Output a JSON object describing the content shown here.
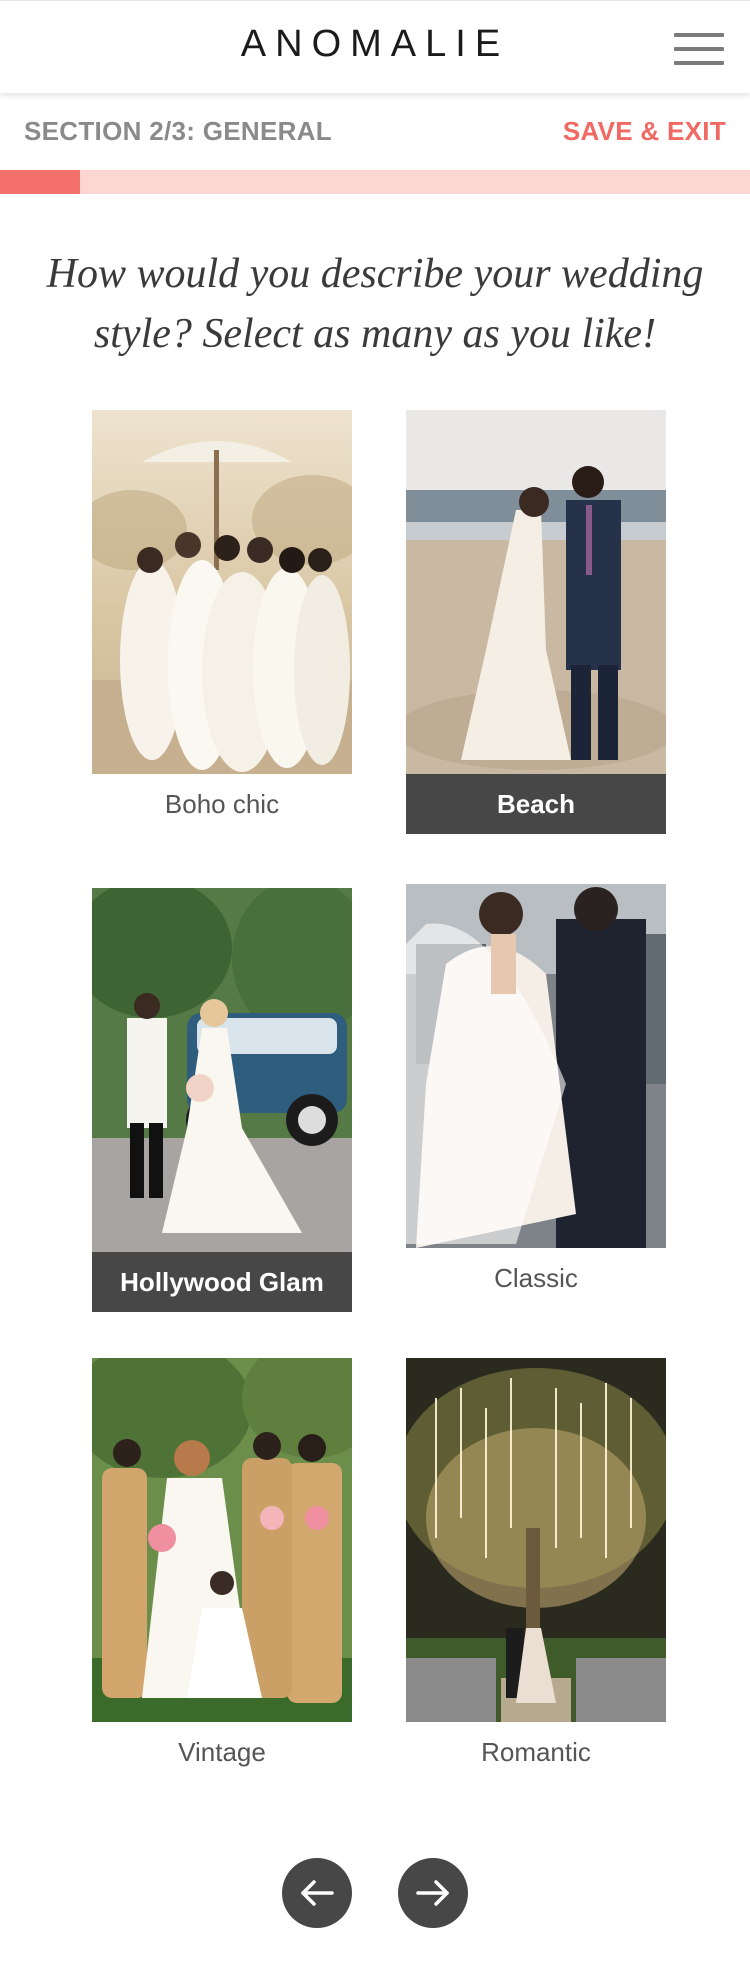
{
  "header": {
    "logo": "ANOMALIE"
  },
  "section": {
    "label": "SECTION 2/3: GENERAL",
    "save_exit": "SAVE & EXIT",
    "progress_fraction": 0.107
  },
  "question": {
    "line1": "How would you describe your wedding",
    "line2": "style? Select as many as you like!"
  },
  "styles": [
    {
      "label": "Boho chic",
      "selected": false,
      "image": "boho-photo"
    },
    {
      "label": "Beach",
      "selected": true,
      "image": "beach-photo"
    },
    {
      "label": "Hollywood Glam",
      "selected": true,
      "image": "hollywood-photo"
    },
    {
      "label": "Classic",
      "selected": false,
      "image": "classic-photo"
    },
    {
      "label": "Vintage",
      "selected": false,
      "image": "vintage-photo"
    },
    {
      "label": "Romantic",
      "selected": false,
      "image": "romantic-photo"
    }
  ],
  "navigation": {
    "back_icon": "arrow-left-icon",
    "next_icon": "arrow-right-icon"
  },
  "colors": {
    "accent": "#f06a63",
    "progress_track": "#fdd5d2",
    "selected_caption": "#474747"
  }
}
